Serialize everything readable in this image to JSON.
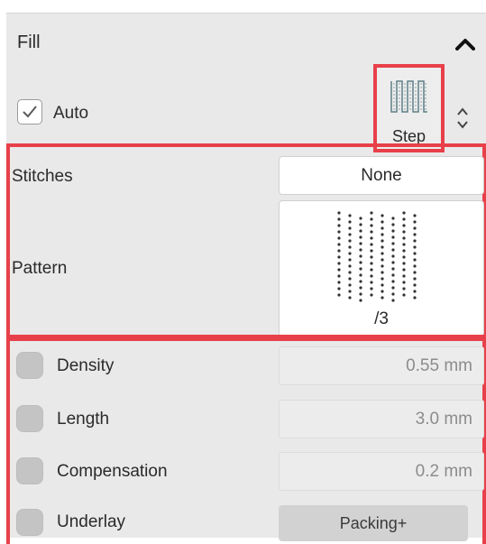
{
  "panel": {
    "title": "Fill",
    "collapse_icon": "chevron-up-icon"
  },
  "auto": {
    "label": "Auto",
    "checked": true
  },
  "step": {
    "label": "Step",
    "icon": "step-stitch-icon",
    "spinner_icon": "up-down-chevron-icon"
  },
  "stitches": {
    "label": "Stitches",
    "value": "None"
  },
  "pattern": {
    "label": "Pattern",
    "value": "/3"
  },
  "params": [
    {
      "label": "Density",
      "value": "0.55 mm",
      "enabled": false
    },
    {
      "label": "Length",
      "value": "3.0 mm",
      "enabled": false
    },
    {
      "label": "Compensation",
      "value": "0.2 mm",
      "enabled": false
    }
  ],
  "underlay": {
    "label": "Underlay",
    "value": "Packing+",
    "enabled": false
  },
  "colors": {
    "highlight": "#e8404a",
    "panel_bg": "#e9e9e9"
  }
}
